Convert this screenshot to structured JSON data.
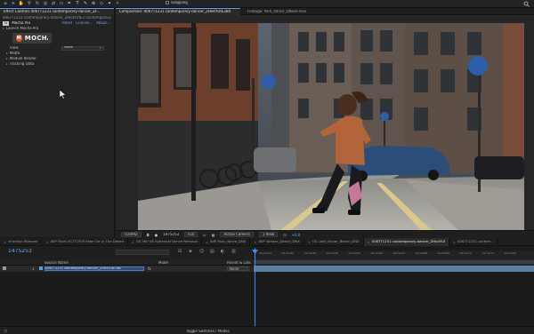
{
  "toolbar": {
    "tools": [
      "home-icon",
      "selection-arrow-icon",
      "hand-icon",
      "zoom-icon",
      "rotate-icon",
      "camera-orbit-icon",
      "pan-behind-icon",
      "rectangle-mask-icon",
      "pen-icon",
      "type-icon",
      "brush-icon",
      "clone-stamp-icon",
      "eraser-icon",
      "roto-brush-icon",
      "puppet-pin-icon"
    ],
    "snapping_label": "Snapping",
    "search_icon": "search-icon"
  },
  "effects_panel": {
    "tab_label": "Effect Controls 0067T1231 contemporary-dancer_ZF...",
    "subtitle": "0067T1231 contemporary-dancer_ZHe4YUtE3 contemporary",
    "effect_name": "Mocha Pro",
    "reset_label": "Reset",
    "license_label": "License...",
    "about_label": "About...",
    "logo_text": "MOCHA",
    "launch_label": "Launch Mocha Pro",
    "view_label": "View",
    "view_value": "Matte",
    "groups": [
      "Matte",
      "Module Render",
      "Tracking Data"
    ]
  },
  "viewer": {
    "tabs": [
      {
        "label": "Composition: 0067T1231 contemporary-dancer_ZHe4YUtE3B0",
        "active": true
      },
      {
        "label": "Footage: Park_dance_DNxHr.mov",
        "active": false
      }
    ],
    "footer": {
      "zoom": "(100%)",
      "timecode": "1475253",
      "resolution": "Full",
      "camera": "Active Camera",
      "views": "1 View",
      "offset": "+0.0"
    }
  },
  "timeline": {
    "tabs": [
      "of action Remove",
      "WIP Finds XC7T1500 Fake Car in The Desert",
      "OS 360 VR Spherical Dance Remove",
      "WIP Park_dance_DNX",
      "WIP Vandas_Dance_DNX",
      "OS Lake_Hover_Beach_DNX",
      "0067T1231 contemporary-dancer_ZHe4YUtE3B0",
      "0067T1231 contem..."
    ],
    "active_tab_index": 6,
    "current_time": "1475253",
    "source_name_header": "Source Name",
    "mode_header": "Mode",
    "parent_header": "Parent & Link",
    "layer": {
      "number": "1",
      "name": "0067T1231 contemporary-dancer_ZHe4YUtE3B0",
      "parent": "None"
    },
    "ruler_labels": [
      "1475225",
      "1475230",
      "1475235",
      "1475240",
      "1475245",
      "1475250",
      "1475255",
      "1475260",
      "1475265",
      "1475270",
      "1475275",
      "1475280"
    ],
    "footer_label": "Toggle Switches / Modes"
  }
}
